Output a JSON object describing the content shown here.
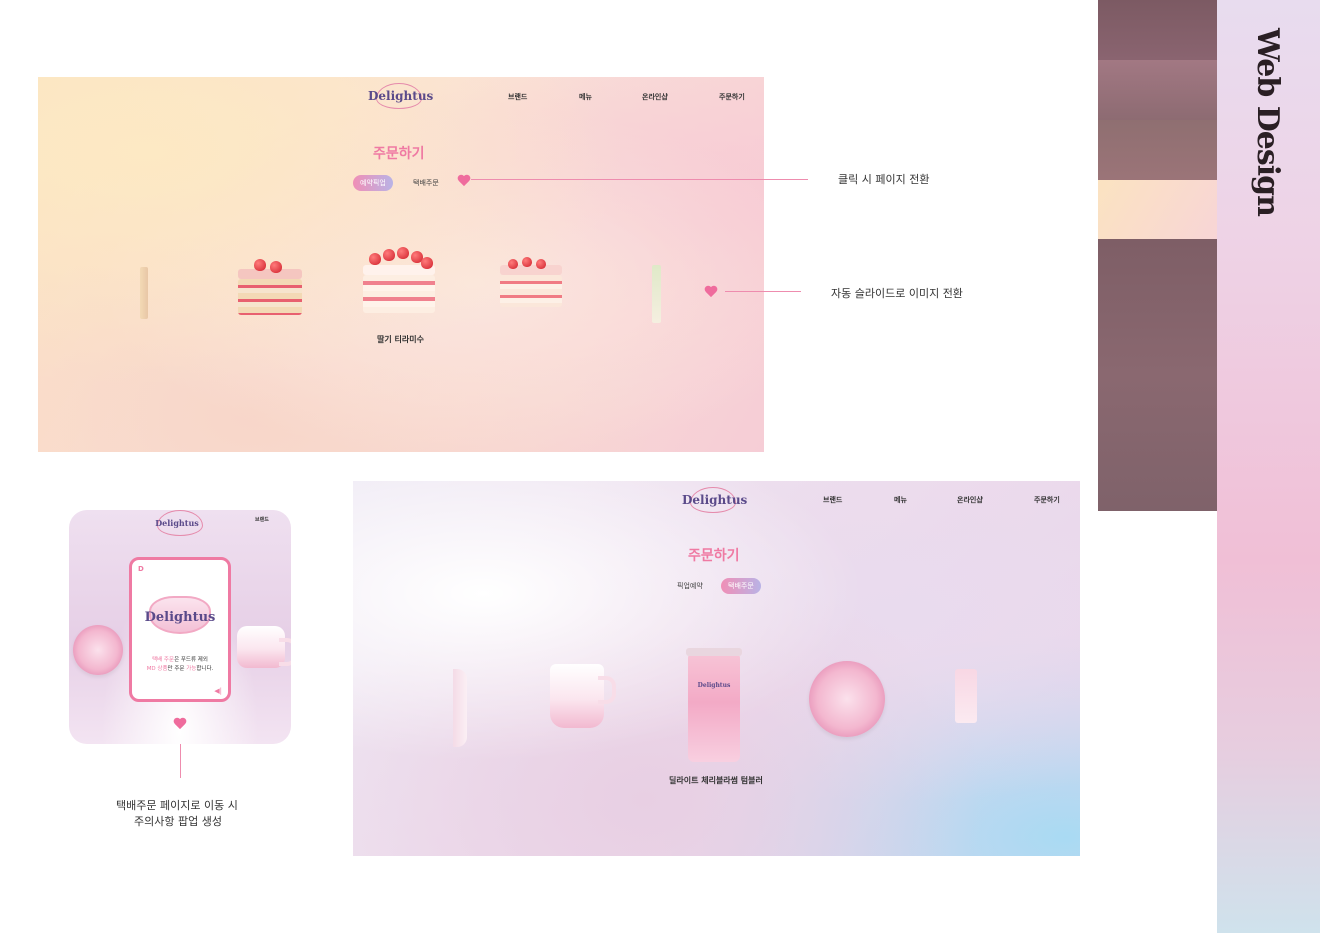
{
  "portfolio": {
    "section_title": "Web Design"
  },
  "header": {
    "logo_text": "Delightus",
    "nav": [
      "브랜드",
      "메뉴",
      "온라인샵",
      "주문하기"
    ]
  },
  "mockup_pickup": {
    "page_title": "주문하기",
    "tab_active": "예약픽업",
    "tab_inactive": "택배주문",
    "featured_caption": "딸기 티라미수"
  },
  "mockup_delivery": {
    "page_title": "주문하기",
    "tab_inactive": "픽업예약",
    "tab_active": "택배주문",
    "featured_caption": "딜라이트 체리블라썸 텀블러"
  },
  "mobile": {
    "logo_text": "Delightus",
    "nav_item": "브랜드",
    "popup": {
      "logo_text": "Delightus",
      "line1_highlight": "택배 주문",
      "line1_rest": "은 푸드류 제외",
      "line2_highlight": "MD 상품",
      "line2_mid": "만 주문 ",
      "line2_highlight2": "가능",
      "line2_rest": "합니다."
    }
  },
  "annotations": {
    "tab_click": "클릭 시 페이지 전환",
    "auto_slide": "자동 슬라이드로 이미지 전환",
    "popup_line1": "택배주문 페이지로 이동 시",
    "popup_line2": "주의사항 팝업 생성"
  },
  "colors": {
    "accent_pink": "#ef7aa3",
    "logo_purple": "#5a4a8a"
  }
}
